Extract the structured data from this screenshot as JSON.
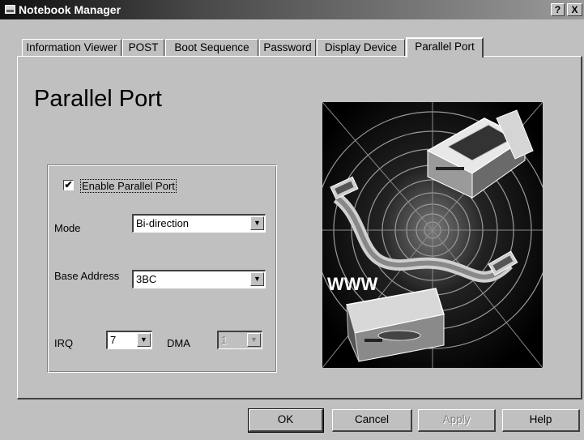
{
  "window": {
    "title": "Notebook Manager",
    "help_button": "?",
    "close_button": "X"
  },
  "tabs": [
    {
      "label": "Information Viewer"
    },
    {
      "label": "POST"
    },
    {
      "label": "Boot Sequence"
    },
    {
      "label": "Password"
    },
    {
      "label": "Display Device"
    },
    {
      "label": "Parallel Port",
      "active": true
    }
  ],
  "page": {
    "title": "Parallel Port",
    "enable_checkbox": {
      "label": "Enable Parallel Port",
      "checked": true,
      "mark": "✔"
    },
    "mode": {
      "label": "Mode",
      "value": "Bi-direction"
    },
    "base_address": {
      "label": "Base Address",
      "value": "3BC"
    },
    "irq": {
      "label": "IRQ",
      "value": "7"
    },
    "dma": {
      "label": "DMA",
      "value": "1",
      "disabled": true
    },
    "illustration_text": "WWW",
    "dropdown_glyph": "▼"
  },
  "buttons": {
    "ok": "OK",
    "cancel": "Cancel",
    "apply": "Apply",
    "help": "Help"
  }
}
